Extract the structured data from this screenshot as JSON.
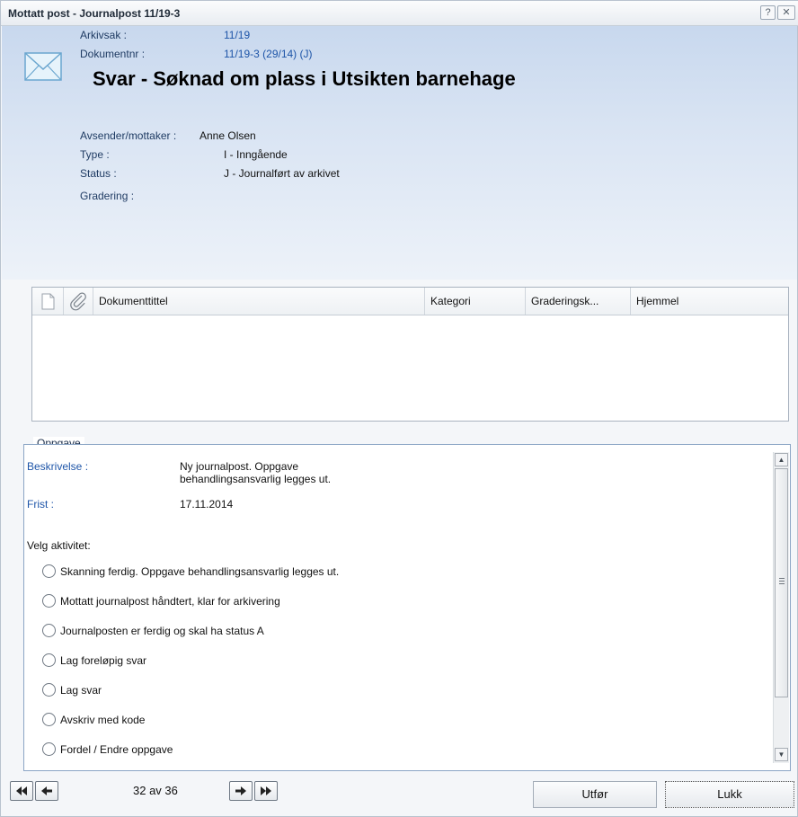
{
  "window": {
    "title": "Mottatt post - Journalpost 11/19-3",
    "help_label": "?",
    "close_label": "✕"
  },
  "header": {
    "icon": "envelope-icon",
    "arkivsak_label": "Arkivsak :",
    "arkivsak_value": "11/19",
    "dokumentnr_label": "Dokumentnr :",
    "dokumentnr_value": "11/19-3 (29/14) (J)",
    "title": "Svar - Søknad om plass i Utsikten barnehage",
    "avsender_label": "Avsender/mottaker :",
    "avsender_value": "Anne Olsen",
    "type_label": "Type :",
    "type_value": "I - Inngående",
    "status_label": "Status :",
    "status_value": "J - Journalført av arkivet",
    "gradering_label": "Gradering :"
  },
  "documents_table": {
    "columns": [
      "Dokumenttittel",
      "Kategori",
      "Graderingsk...",
      "Hjemmel"
    ],
    "rows": []
  },
  "task": {
    "legend": "Oppgave",
    "beskrivelse_label": "Beskrivelse :",
    "beskrivelse_line1": "Ny journalpost. Oppgave",
    "beskrivelse_line2": "behandlingsansvarlig legges ut.",
    "frist_label": "Frist :",
    "frist_value": "17.11.2014",
    "velg_label": "Velg aktivitet:",
    "activities": [
      "Skanning ferdig. Oppgave behandlingsansvarlig legges ut.",
      "Mottatt journalpost håndtert, klar for arkivering",
      "Journalposten er ferdig og skal ha status A",
      "Lag foreløpig svar",
      "Lag svar",
      "Avskriv med kode",
      "Fordel / Endre oppgave"
    ]
  },
  "footer": {
    "counter": "32 av 36",
    "utfor_label": "Utfør",
    "lukk_label": "Lukk"
  },
  "colors": {
    "accent_blue": "#1e55a8",
    "header_gradient_top": "#c8d8ee",
    "fieldset_border": "#8ba5c5"
  }
}
